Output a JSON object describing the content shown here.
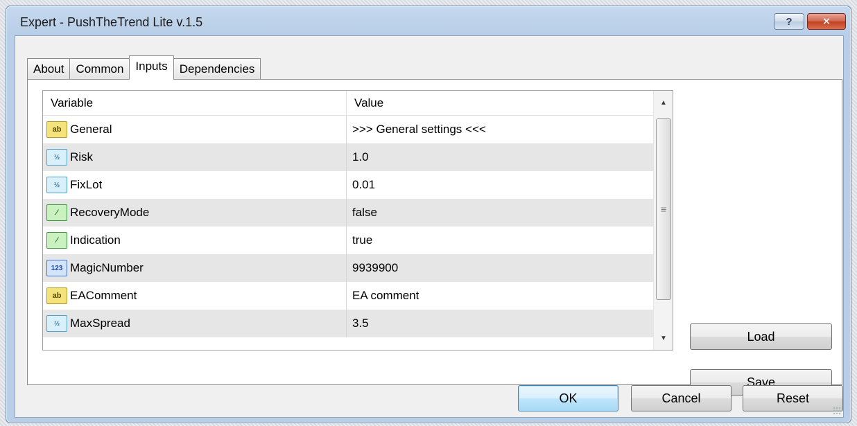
{
  "window": {
    "title": "Expert - PushTheTrend Lite v.1.5",
    "help_label": "?",
    "close_label": "✕"
  },
  "tabs": [
    {
      "label": "About",
      "active": false
    },
    {
      "label": "Common",
      "active": false
    },
    {
      "label": "Inputs",
      "active": true
    },
    {
      "label": "Dependencies",
      "active": false
    }
  ],
  "grid": {
    "columns": {
      "variable": "Variable",
      "value": "Value"
    },
    "rows": [
      {
        "icon": "ab",
        "icon_text": "ab",
        "variable": "General",
        "value": ">>> General settings <<<"
      },
      {
        "icon": "real",
        "icon_text": "½",
        "variable": "Risk",
        "value": "1.0"
      },
      {
        "icon": "real",
        "icon_text": "½",
        "variable": "FixLot",
        "value": "0.01"
      },
      {
        "icon": "bool",
        "icon_text": "⁄",
        "variable": "RecoveryMode",
        "value": "false"
      },
      {
        "icon": "bool",
        "icon_text": "⁄",
        "variable": "Indication",
        "value": "true"
      },
      {
        "icon": "int",
        "icon_text": "123",
        "variable": "MagicNumber",
        "value": "9939900"
      },
      {
        "icon": "ab",
        "icon_text": "ab",
        "variable": "EAComment",
        "value": "EA comment"
      },
      {
        "icon": "real",
        "icon_text": "½",
        "variable": "MaxSpread",
        "value": "3.5"
      }
    ]
  },
  "buttons": {
    "load": "Load",
    "save": "Save",
    "ok": "OK",
    "cancel": "Cancel",
    "reset": "Reset"
  },
  "scrollbar": {
    "up_glyph": "▲",
    "down_glyph": "▼",
    "grip_glyph": "≡"
  }
}
